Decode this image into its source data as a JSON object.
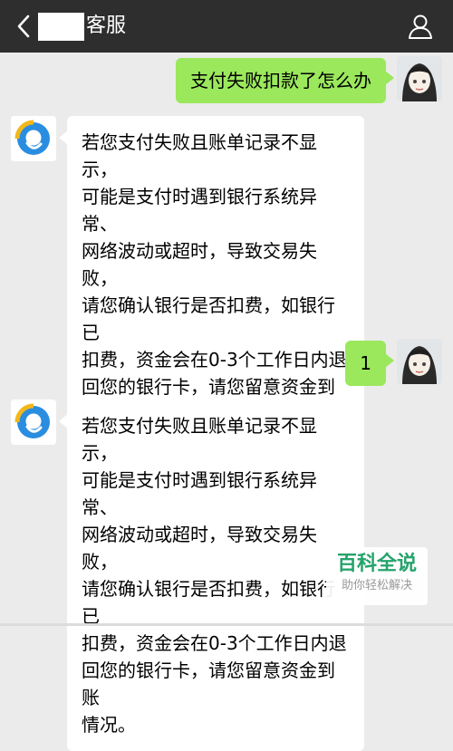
{
  "header": {
    "title": "客服",
    "back_icon": "chevron-left-icon",
    "profile_icon": "person-icon"
  },
  "messages": [
    {
      "sender": "user",
      "text": "支付失败扣款了怎么办"
    },
    {
      "sender": "bot",
      "text": "若您支付失败且账单记录不显示，\n可能是支付时遇到银行系统异常、\n网络波动或超时，导致交易失败，\n请您确认银行是否扣费，如银行已\n扣费，资金会在0-3个工作日内退\n回您的银行卡，请您留意资金到账\n情况。"
    },
    {
      "sender": "user",
      "text": "1"
    },
    {
      "sender": "bot",
      "text": "若您支付失败且账单记录不显示，\n可能是支付时遇到银行系统异常、\n网络波动或超时，导致交易失败，\n请您确认银行是否扣费，如银行已\n扣费，资金会在0-3个工作日内退\n回您的银行卡，请您留意资金到账\n情况。"
    }
  ],
  "watermark": {
    "title": "百科全说",
    "subtitle": "助你轻松解决"
  },
  "colors": {
    "header_bg": "#2e2e2e",
    "chat_bg": "#ebebeb",
    "user_bubble": "#9be85c",
    "bot_bubble": "#ffffff",
    "watermark_green": "#25a36b"
  }
}
